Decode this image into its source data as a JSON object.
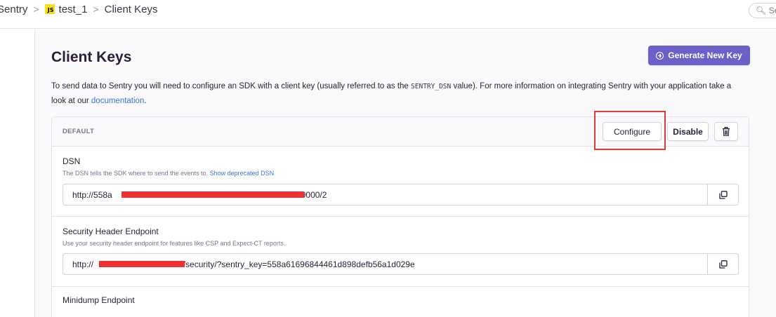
{
  "breadcrumb": {
    "org": "Sentry",
    "project": "test_1",
    "page": "Client Keys",
    "js_badge": "JS"
  },
  "search": {
    "placeholder": "Search"
  },
  "page": {
    "title": "Client Keys",
    "generate_button": "Generate New Key",
    "description_part1": "To send data to Sentry you will need to configure an SDK with a client key (usually referred to as the",
    "description_code": "SENTRY_DSN",
    "description_part2": "value). For more information on integrating Sentry with your application take a look at our",
    "description_link": "documentation",
    "description_end": "."
  },
  "key_card": {
    "label": "DEFAULT",
    "configure_button": "Configure",
    "disable_button": "Disable",
    "delete_icon": "trash-icon",
    "dsn": {
      "title": "DSN",
      "help": "The DSN tells the SDK where to send the events to.",
      "help_link": "Show deprecated DSN",
      "value_prefix": "http://558a",
      "value_suffix": "6:9000/2"
    },
    "security": {
      "title": "Security Header Endpoint",
      "help": "Use your security header endpoint for features like CSP and Expect-CT reports.",
      "value_prefix": "http://",
      "value_suffix": "2/security/?sentry_key=558a61696844461d898defb56a1d029e"
    },
    "minidump": {
      "title": "Minidump Endpoint"
    }
  },
  "colors": {
    "accent": "#6c5fc7",
    "link": "#3d74db",
    "highlight": "#e53935"
  }
}
